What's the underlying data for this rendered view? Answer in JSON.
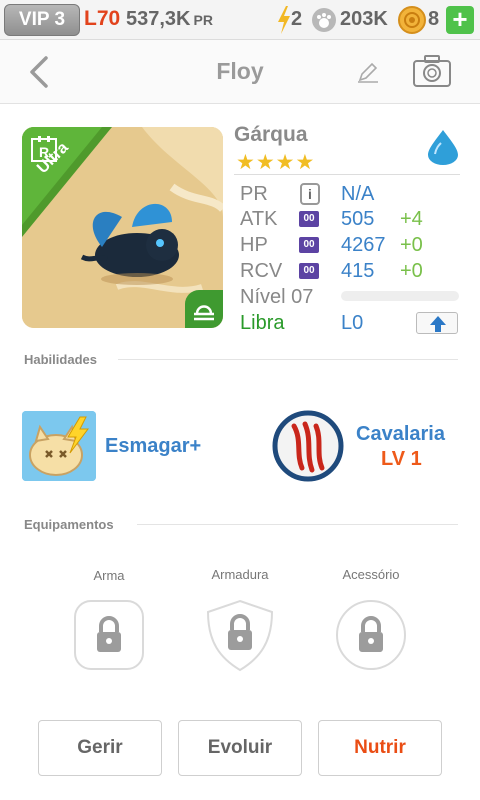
{
  "topbar": {
    "vip": "VIP 3",
    "level": "L70",
    "power": "537,3K",
    "power_unit": "PR",
    "energy": "2",
    "paws": "203K",
    "coins": "8",
    "add": "+"
  },
  "header": {
    "title": "Floy"
  },
  "pet": {
    "rarity_badge": "R",
    "rarity_label": "Ultra",
    "name": "Gárqua",
    "stars": "★★★★",
    "star_count": 4,
    "element_color": "#2f9fd9"
  },
  "stats": {
    "pr_label": "PR",
    "pr_value": "N/A",
    "info_icon": "i",
    "atk_label": "ATK",
    "atk_value": "505",
    "atk_bonus": "+4",
    "hp_label": "HP",
    "hp_value": "4267",
    "hp_bonus": "+0",
    "rcv_label": "RCV",
    "rcv_value": "415",
    "rcv_bonus": "+0",
    "stat_icon": "00",
    "level_label": "Nível 07",
    "exp_fraction": 0.0,
    "zodiac": "Libra",
    "star_level": "L0"
  },
  "skills": {
    "title": "Habilidades",
    "skill1_name": "Esmagar+",
    "skill2_name": "Cavalaria",
    "skill2_level": "LV 1"
  },
  "equipment": {
    "title": "Equipamentos",
    "weapon": "Arma",
    "armor": "Armadura",
    "accessory": "Acessório"
  },
  "actions": {
    "manage": "Gerir",
    "evolve": "Evoluir",
    "feed": "Nutrir"
  },
  "colors": {
    "accent_blue": "#3b82c8",
    "bonus_green": "#79c04a",
    "primary_action": "#ea4d14",
    "level_red": "#e2431c"
  }
}
